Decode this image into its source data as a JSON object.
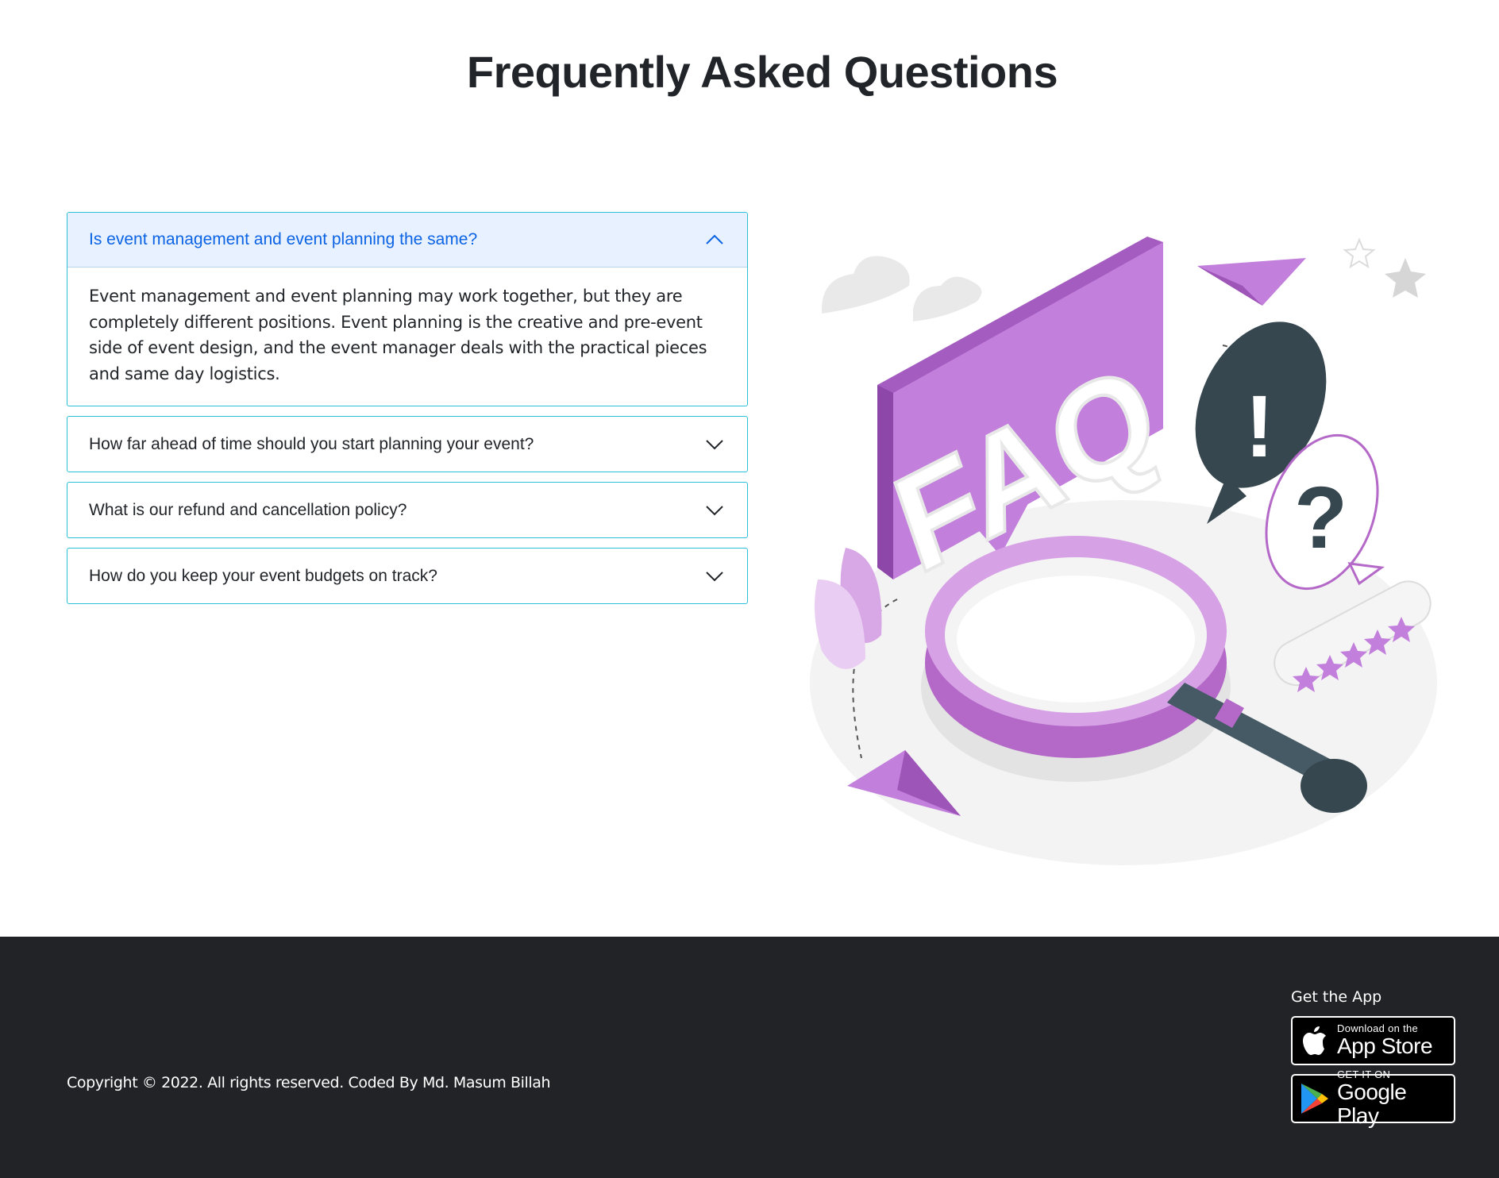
{
  "header": {
    "title": "Frequently Asked Questions"
  },
  "faq": {
    "items": [
      {
        "question": "Is event management and event planning the same?",
        "answer": "Event management and event planning may work together, but they are completely different positions. Event planning is the creative and pre-event side of event design, and the event manager deals with the practical pieces and same day logistics.",
        "expanded": true
      },
      {
        "question": "How far ahead of time should you start planning your event?",
        "expanded": false
      },
      {
        "question": "What is our refund and cancellation policy?",
        "expanded": false
      },
      {
        "question": "How do you keep your event budgets on track?",
        "expanded": false
      }
    ]
  },
  "illustration": {
    "sign_text": "FAQ",
    "bubble_exclaim": "!",
    "bubble_question": "?"
  },
  "footer": {
    "copyright": "Copyright © 2022. All rights reserved. Coded By Md. Masum Billah",
    "get_app_title": "Get the App",
    "app_store": {
      "small": "Download on the",
      "big": "App Store"
    },
    "google_play": {
      "small": "GET IT ON",
      "big": "Google Play"
    }
  },
  "colors": {
    "accordion_border": "#2bc0d8",
    "active_header_bg": "#e7f1ff",
    "active_header_text": "#0c63e4",
    "purple": "#b96fcf",
    "footer_bg": "#212327"
  }
}
